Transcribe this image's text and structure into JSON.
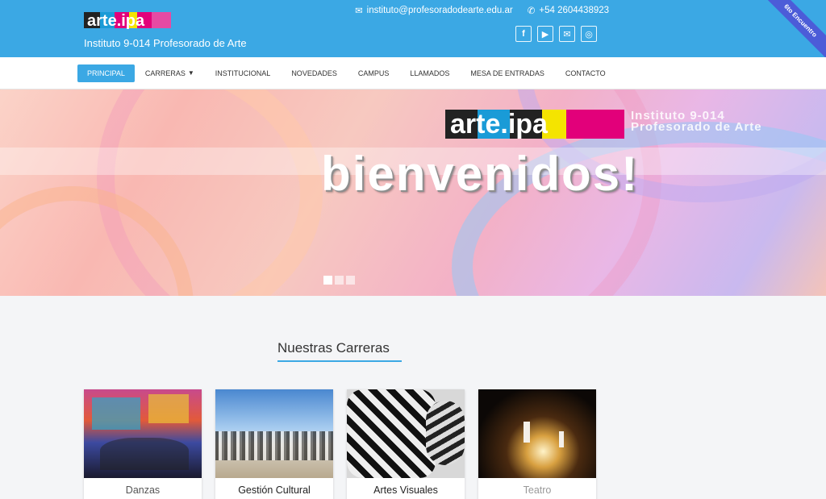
{
  "header": {
    "logo_text": "arte.ipa",
    "site_name": "Instituto 9-014 Profesorado de Arte",
    "email": "instituto@profesoradodearte.edu.ar",
    "phone": "+54 2604438923",
    "ribbon": "6to Encuentro",
    "socials": [
      {
        "name": "facebook",
        "glyph": "f"
      },
      {
        "name": "youtube",
        "glyph": "▶"
      },
      {
        "name": "email",
        "glyph": "✉"
      },
      {
        "name": "instagram",
        "glyph": "◎"
      }
    ]
  },
  "nav": {
    "items": [
      "PRINCIPAL",
      "CARRERAS",
      "INSTITUCIONAL",
      "NOVEDADES",
      "CAMPUS",
      "LLAMADOS",
      "MESA DE ENTRADAS",
      "CONTACTO"
    ]
  },
  "hero": {
    "logo_text": "arte.ipa",
    "subtitle_line1": "Instituto 9-014",
    "subtitle_line2": "Profesorado de Arte",
    "title": "bienvenidos!",
    "slides": 3,
    "active_slide": 1
  },
  "section": {
    "title": "Nuestras Carreras",
    "cards": [
      "Danzas",
      "Gestión Cultural",
      "Artes Visuales",
      "Teatro"
    ]
  },
  "colors": {
    "primary": "#3ba8e4",
    "ribbon": "#4c5cd8"
  }
}
